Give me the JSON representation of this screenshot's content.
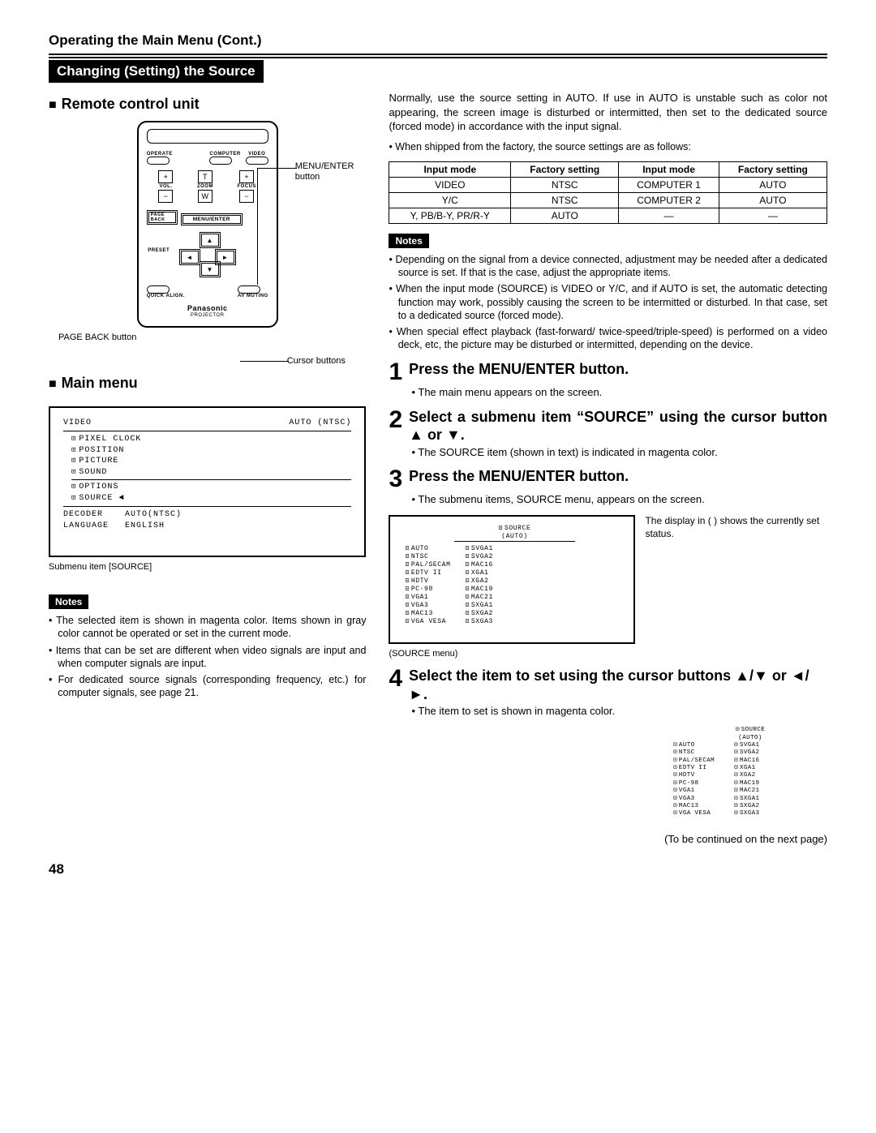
{
  "header": "Operating the Main Menu (Cont.)",
  "section_bar": "Changing (Setting) the Source",
  "left": {
    "remote_heading": "Remote control unit",
    "callouts": {
      "menu_enter": "MENU/ENTER button",
      "cursor": "Cursor buttons",
      "page_back": "PAGE BACK button"
    },
    "remote": {
      "operate": "OPERATE",
      "computer": "COMPUTER",
      "video": "VIDEO",
      "vol": "VOL.",
      "zoom": "ZOOM",
      "focus": "FOCUS",
      "page_back": "PAGE BACK",
      "menu_enter": "MENU/ENTER",
      "preset": "PRESET",
      "quick_align": "QUICK ALIGN.",
      "av_muting": "AV MUTING",
      "brand": "Panasonic",
      "model": "PROJECTOR",
      "t": "T",
      "w": "W",
      "plus": "+",
      "minus": "−"
    },
    "main_menu_heading": "Main menu",
    "menu": {
      "video": "VIDEO",
      "auto_ntsc": "AUTO (NTSC)",
      "items": [
        "PIXEL CLOCK",
        "POSITION",
        "PICTURE",
        "SOUND",
        "OPTIONS",
        "SOURCE"
      ],
      "decoder": "DECODER",
      "decoder_val": "AUTO(NTSC)",
      "language": "LANGUAGE",
      "language_val": "ENGLISH"
    },
    "menu_caption": "Submenu item [SOURCE]",
    "notes_label": "Notes",
    "notes": [
      "The selected item is shown in magenta color. Items shown in gray color cannot be operated or set in the current mode.",
      "Items that can be set are different when video signals are input and when computer signals are input.",
      "For dedicated source signals (corresponding frequency, etc.) for computer signals, see page 21."
    ]
  },
  "right": {
    "intro": "Normally, use the source setting in AUTO. If use in AUTO is unstable such as color not appearing, the screen image is disturbed or intermitted, then set to the dedicated source (forced mode) in accordance with the input signal.",
    "shipped": "When shipped from the factory, the source settings are as follows:",
    "table": {
      "h1": "Input mode",
      "h2": "Factory setting",
      "h3": "Input mode",
      "h4": "Factory setting",
      "rows": [
        [
          "VIDEO",
          "NTSC",
          "COMPUTER 1",
          "AUTO"
        ],
        [
          "Y/C",
          "NTSC",
          "COMPUTER 2",
          "AUTO"
        ],
        [
          "Y, PB/B-Y, PR/R-Y",
          "AUTO",
          "—",
          "—"
        ]
      ]
    },
    "notes_label": "Notes",
    "notes": [
      "Depending on the signal from a device connected, adjustment may be needed after a dedicated source is set. If that is the case, adjust the appropriate items.",
      "When the input mode (SOURCE) is VIDEO or Y/C, and if AUTO is set, the automatic detecting function may work, possibly causing the screen to be intermitted or disturbed. In that case, set to a dedicated source (forced mode).",
      "When special effect playback (fast-forward/ twice-speed/triple-speed) is performed on a video deck, etc, the picture may be disturbed or intermitted, depending on the device."
    ],
    "steps": [
      {
        "num": "1",
        "title": "Press the MENU/ENTER button.",
        "sub": "The main menu appears on the screen."
      },
      {
        "num": "2",
        "title": "Select a submenu item “SOURCE” using the cursor button ▲ or ▼.",
        "sub": "The SOURCE item (shown in text) is indicated in magenta color."
      },
      {
        "num": "3",
        "title": "Press the MENU/ENTER button.",
        "sub": "The submenu items, SOURCE menu, appears on the screen."
      },
      {
        "num": "4",
        "title": "Select the item to set using the cursor buttons ▲/▼ or ◄/►.",
        "sub": "The item to set is shown in magenta color."
      }
    ],
    "source_box": {
      "title": "SOURCE",
      "auto": "(AUTO)",
      "col1": [
        "AUTO",
        "NTSC",
        "PAL/SECAM",
        "EDTV II",
        "HDTV",
        "PC-98",
        "VGA1",
        "VGA3",
        "MAC13",
        "VGA VESA"
      ],
      "col2": [
        "SVGA1",
        "SVGA2",
        "MAC16",
        "XGA1",
        "XGA2",
        "MAC19",
        "MAC21",
        "SXGA1",
        "SXGA2",
        "SXGA3"
      ],
      "caption": "(SOURCE menu)",
      "side_note": "The display in ( ) shows the currently set status."
    },
    "continued": "(To be continued on the next page)"
  },
  "page_number": "48"
}
